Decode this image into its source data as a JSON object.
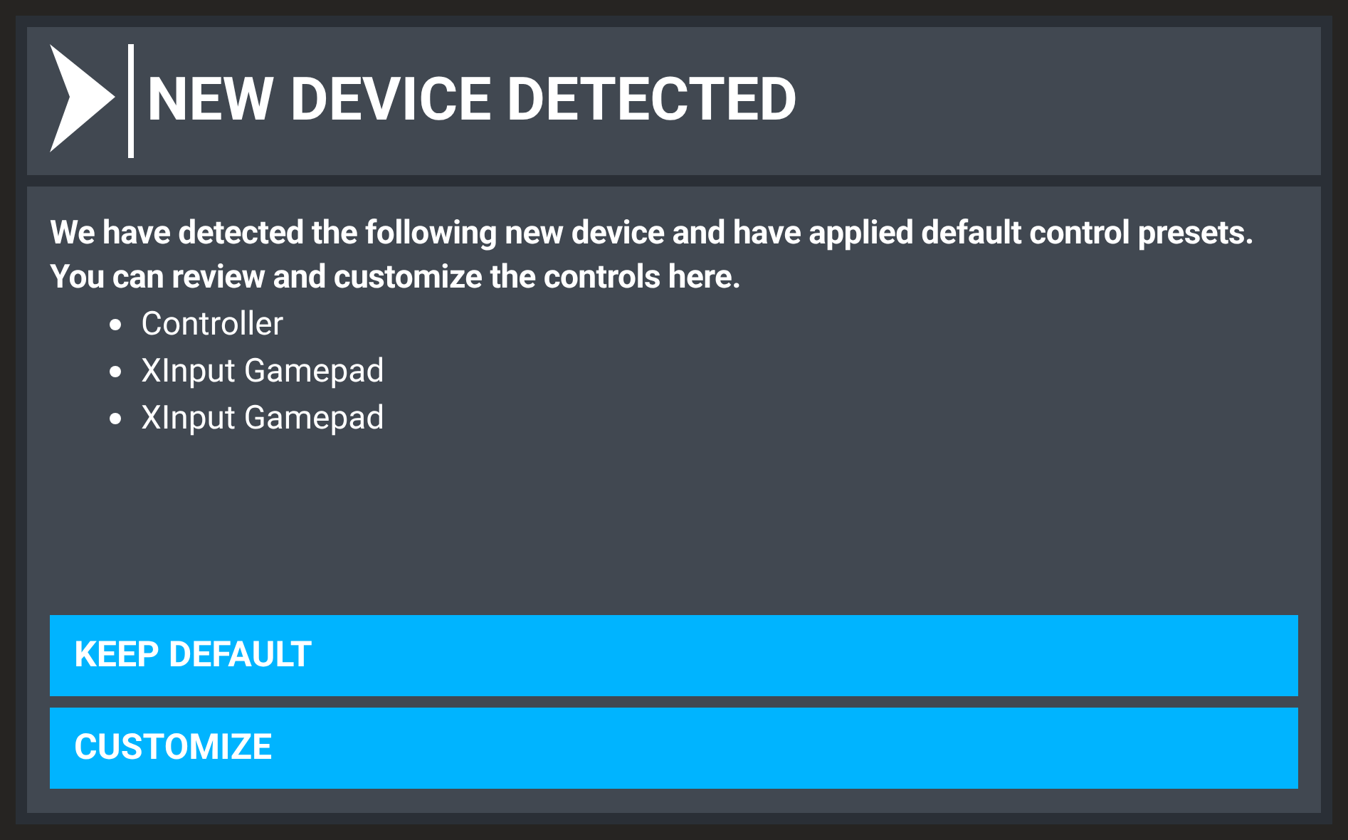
{
  "dialog": {
    "title": "NEW DEVICE DETECTED",
    "message": "We have detected the following new device and have applied default control presets. You can review and customize the controls here.",
    "devices": [
      "Controller",
      "XInput Gamepad",
      "XInput Gamepad"
    ],
    "buttons": [
      "KEEP DEFAULT",
      "CUSTOMIZE"
    ]
  }
}
